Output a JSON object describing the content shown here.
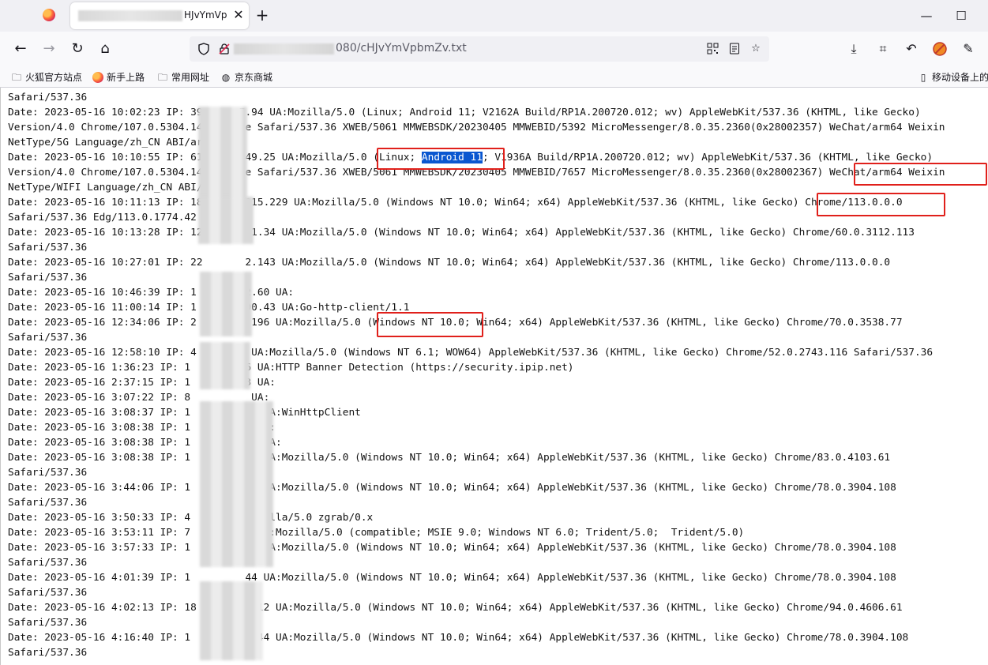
{
  "tab": {
    "title": "HJvYmVp",
    "close": "✕"
  },
  "window": {
    "minimize": "—",
    "maximize": "☐"
  },
  "nav": {
    "back": "←",
    "forward": "→",
    "reload": "↻",
    "home": "⌂"
  },
  "urlbar": {
    "url": "080/cHJvYmVpbmZv.txt"
  },
  "bookmarks": [
    {
      "label": "火狐官方站点",
      "icon": "folder-icon"
    },
    {
      "label": "新手上路",
      "icon": "firefox-icon"
    },
    {
      "label": "常用网址",
      "icon": "folder-icon"
    },
    {
      "label": "京东商城",
      "icon": "globe-icon"
    },
    {
      "label": "移动设备上的",
      "icon": "mobile-icon"
    }
  ],
  "log_lines": [
    "Safari/537.36",
    "Date: 2023-05-16 10:02:23 IP: 39.     7.94 UA:Mozilla/5.0 (Linux; Android 11; V2162A Build/RP1A.200720.012; wv) AppleWebKit/537.36 (KHTML, like Gecko)",
    "Version/4.0 Chrome/107.0.5304.141      e Safari/537.36 XWEB/5061 MMWEBSDK/20230405 MMWEBID/5392 MicroMessenger/8.0.35.2360(0x28002357) WeChat/arm64 Weixin",
    "NetType/5G Language/zh_CN ABI/arm",
    "Date: 2023-05-16 10:10:55 IP: 61.      49.25 UA:Mozilla/5.0 (Linux; Android 11; V1936A Build/RP1A.200720.012; wv) AppleWebKit/537.36 (KHTML, like Gecko)",
    "Version/4.0 Chrome/107.0.5304.141      e Safari/537.36 XWEB/5061 MMWEBSDK/20230405 MMWEBID/7657 MicroMessenger/8.0.35.2360(0x28002367) WeChat/arm64 Weixin",
    "NetType/WIFI Language/zh_CN ABI/a",
    "Date: 2023-05-16 10:11:13 IP: 183      215.229 UA:Mozilla/5.0 (Windows NT 10.0; Win64; x64) AppleWebKit/537.36 (KHTML, like Gecko) Chrome/113.0.0.0",
    "Safari/537.36 Edg/113.0.1774.42",
    "Date: 2023-05-16 10:13:28 IP: 128      41.34 UA:Mozilla/5.0 (Windows NT 10.0; Win64; x64) AppleWebKit/537.36 (KHTML, like Gecko) Chrome/60.0.3112.113",
    "Safari/537.36",
    "Date: 2023-05-16 10:27:01 IP: 22       2.143 UA:Mozilla/5.0 (Windows NT 10.0; Win64; x64) AppleWebKit/537.36 (KHTML, like Gecko) Chrome/113.0.0.0",
    "Safari/537.36",
    "Date: 2023-05-16 10:46:39 IP: 1      .52.60 UA:",
    "Date: 2023-05-16 11:00:14 IP: 1      .200.43 UA:Go-http-client/1.1",
    "Date: 2023-05-16 12:34:06 IP: 2      41.196 UA:Mozilla/5.0 (Windows NT 10.0; Win64; x64) AppleWebKit/537.36 (KHTML, like Gecko) Chrome/70.0.3538.77",
    "Safari/537.36",
    "Date: 2023-05-16 12:58:10 IP: 4         UA:Mozilla/5.0 (Windows NT 6.1; WOW64) AppleWebKit/537.36 (KHTML, like Gecko) Chrome/52.0.2743.116 Safari/537.36",
    "Date: 2023-05-16 1:36:23 IP: 1         6 UA:HTTP Banner Detection (https://security.ipip.net)",
    "Date: 2023-05-16 2:37:15 IP: 1         3 UA:",
    "Date: 2023-05-16 3:07:22 IP: 8          UA:",
    "Date: 2023-05-16 3:08:37 IP: 1         33 UA:WinHttpClient",
    "Date: 2023-05-16 3:08:38 IP: 1         7 UA:",
    "Date: 2023-05-16 3:08:38 IP: 1         33 UA:",
    "Date: 2023-05-16 3:08:38 IP: 1         26 UA:Mozilla/5.0 (Windows NT 10.0; Win64; x64) AppleWebKit/537.36 (KHTML, like Gecko) Chrome/83.0.4103.61",
    "Safari/537.36",
    "Date: 2023-05-16 3:44:06 IP: 1         44 UA:Mozilla/5.0 (Windows NT 10.0; Win64; x64) AppleWebKit/537.36 (KHTML, like Gecko) Chrome/78.0.3904.108",
    "Safari/537.36",
    "Date: 2023-05-16 3:50:33 IP: 4         Mozilla/5.0 zgrab/0.x",
    "Date: 2023-05-16 3:53:11 IP: 7         2 UA:Mozilla/5.0 (compatible; MSIE 9.0; Windows NT 6.0; Trident/5.0;  Trident/5.0)",
    "Date: 2023-05-16 3:57:33 IP: 1         44 UA:Mozilla/5.0 (Windows NT 10.0; Win64; x64) AppleWebKit/537.36 (KHTML, like Gecko) Chrome/78.0.3904.108",
    "Safari/537.36",
    "Date: 2023-05-16 4:01:39 IP: 1         44 UA:Mozilla/5.0 (Windows NT 10.0; Win64; x64) AppleWebKit/537.36 (KHTML, like Gecko) Chrome/78.0.3904.108",
    "Safari/537.36",
    "Date: 2023-05-16 4:02:13 IP: 18         112 UA:Mozilla/5.0 (Windows NT 10.0; Win64; x64) AppleWebKit/537.36 (KHTML, like Gecko) Chrome/94.0.4606.61",
    "Safari/537.36",
    "Date: 2023-05-16 4:16:40 IP: 1          144 UA:Mozilla/5.0 (Windows NT 10.0; Win64; x64) AppleWebKit/537.36 (KHTML, like Gecko) Chrome/78.0.3904.108",
    "Safari/537.36"
  ],
  "selection": {
    "line": 4,
    "text": "Android 11"
  },
  "colors": {
    "annotation": "#e0201b",
    "selection": "#0a57d0"
  }
}
